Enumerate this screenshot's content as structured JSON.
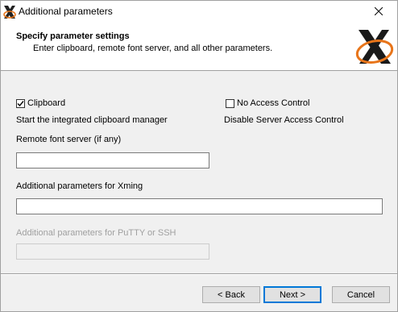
{
  "window": {
    "title": "Additional parameters"
  },
  "header": {
    "title": "Specify parameter settings",
    "subtitle": "Enter clipboard, remote font server, and all other parameters."
  },
  "clipboard": {
    "label": "Clipboard",
    "checked": true,
    "description": "Start the integrated clipboard manager"
  },
  "no_access_control": {
    "label": "No Access Control",
    "checked": false,
    "description": "Disable Server Access Control"
  },
  "font_server": {
    "label": "Remote font server (if any)",
    "value": ""
  },
  "xming_params": {
    "label": "Additional parameters for Xming",
    "value": ""
  },
  "putty_params": {
    "label": "Additional parameters for PuTTY or SSH",
    "value": "",
    "disabled": true
  },
  "buttons": {
    "back": "< Back",
    "next": "Next >",
    "cancel": "Cancel"
  },
  "icons": {
    "app": "xming-x-icon",
    "close": "close-icon",
    "logo": "xming-x-logo"
  },
  "colors": {
    "focus_accent": "#0078d7",
    "logo_orange": "#e8751a",
    "disabled_text": "#a0a0a0"
  }
}
